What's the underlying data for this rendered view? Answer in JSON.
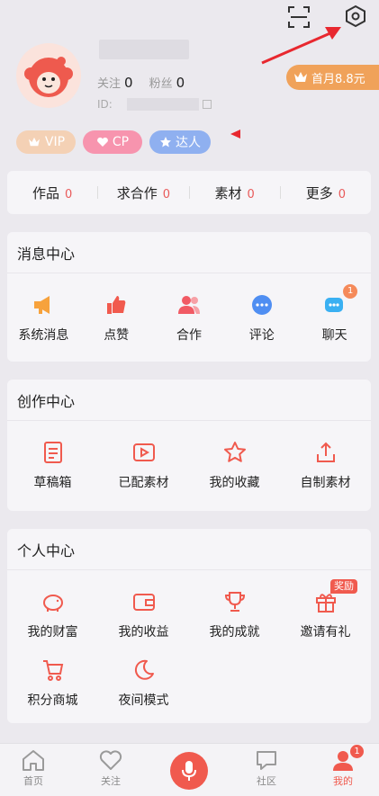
{
  "top": {
    "scan_icon": "scan-icon",
    "settings_icon": "settings-hexagon-icon"
  },
  "profile": {
    "following_label": "关注",
    "following_count": "0",
    "fans_label": "粉丝",
    "fans_count": "0",
    "id_label": "ID:",
    "promo": "首月8.8元",
    "badges": [
      "VIP",
      "CP",
      "达人"
    ]
  },
  "stats": [
    {
      "label": "作品",
      "value": "0"
    },
    {
      "label": "求合作",
      "value": "0"
    },
    {
      "label": "素材",
      "value": "0"
    },
    {
      "label": "更多",
      "value": "0"
    }
  ],
  "message_center": {
    "title": "消息中心",
    "items": [
      {
        "label": "系统消息"
      },
      {
        "label": "点赞"
      },
      {
        "label": "合作"
      },
      {
        "label": "评论"
      },
      {
        "label": "聊天",
        "badge": "1"
      }
    ]
  },
  "creation_center": {
    "title": "创作中心",
    "items": [
      {
        "label": "草稿箱"
      },
      {
        "label": "已配素材"
      },
      {
        "label": "我的收藏"
      },
      {
        "label": "自制素材"
      }
    ]
  },
  "personal_center": {
    "title": "个人中心",
    "items": [
      {
        "label": "我的财富"
      },
      {
        "label": "我的收益"
      },
      {
        "label": "我的成就"
      },
      {
        "label": "邀请有礼",
        "tag": "奖励"
      },
      {
        "label": "积分商城"
      },
      {
        "label": "夜间模式"
      }
    ]
  },
  "tabbar": {
    "items": [
      {
        "label": "首页"
      },
      {
        "label": "关注"
      },
      {
        "label": "社区"
      },
      {
        "label": "我的",
        "badge": "1"
      }
    ]
  },
  "colors": {
    "accent": "#f05a4e",
    "orange": "#f0a25a",
    "pink": "#f78fa8",
    "blue": "#7fa5ef"
  }
}
